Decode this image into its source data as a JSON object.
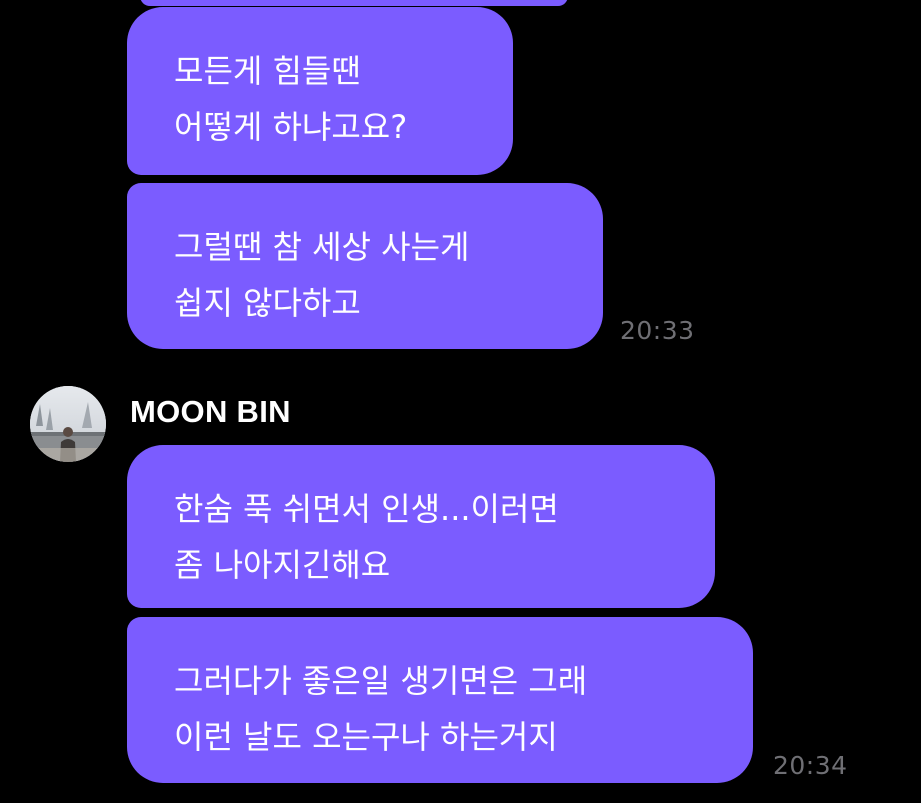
{
  "colors": {
    "background": "#000000",
    "bubble": "#7b5cff",
    "text": "#ffffff",
    "timestamp": "#6f6f74"
  },
  "messages": [
    {
      "lines": [
        "모든게 힘들땐",
        "어떻게 하냐고요?"
      ]
    },
    {
      "lines": [
        "그럴땐 참 세상 사는게",
        "쉽지 않다하고"
      ],
      "time": "20:33"
    },
    {
      "sender": "MOON BIN",
      "avatar_icon": "profile-photo",
      "lines": [
        "한숨 푹 쉬면서 인생...이러면",
        "좀 나아지긴해요"
      ]
    },
    {
      "lines": [
        "그러다가 좋은일 생기면은 그래",
        "이런 날도 오는구나 하는거지"
      ],
      "time": "20:34"
    }
  ]
}
